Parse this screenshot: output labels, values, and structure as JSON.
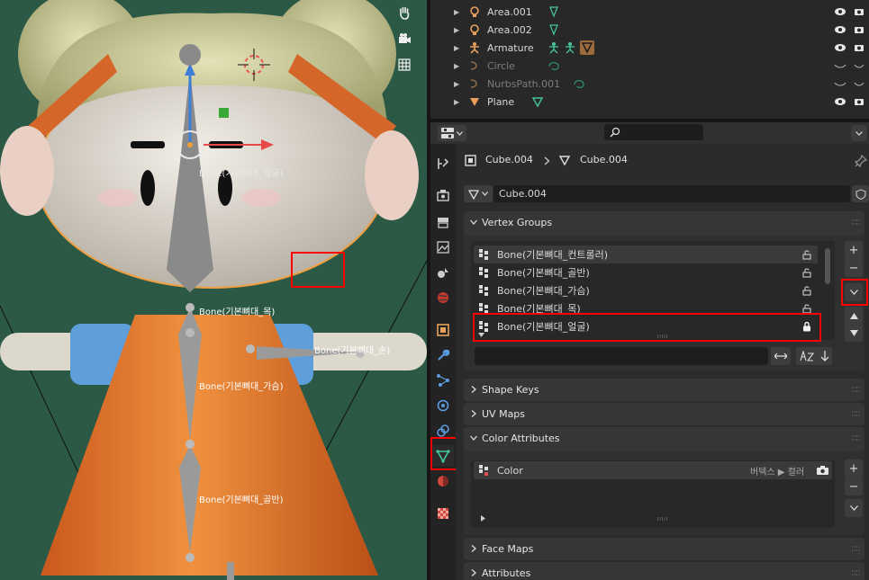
{
  "viewport": {
    "bone_labels": [
      "Bone(기본뼈대_얼굴)",
      "Bone(기본뼈대_목)",
      "Bone(기본뼈대_가슴)",
      "Bone(기본뼈대_골반)",
      "Bone(기본뼈대_손)"
    ]
  },
  "outliner": {
    "rows": [
      {
        "name": "Area.001",
        "icon": "light-icon",
        "dim": false
      },
      {
        "name": "Area.002",
        "icon": "light-icon",
        "dim": false
      },
      {
        "name": "Armature",
        "icon": "armature-icon",
        "dim": false
      },
      {
        "name": "Circle",
        "icon": "curve-icon",
        "dim": true
      },
      {
        "name": "NurbsPath.001",
        "icon": "curve-icon",
        "dim": true
      },
      {
        "name": "Plane",
        "icon": "mesh-icon",
        "dim": false
      }
    ]
  },
  "properties": {
    "breadcrumb_object": "Cube.004",
    "breadcrumb_mesh": "Cube.004",
    "mesh_datablock": "Cube.004",
    "sections": {
      "vertex_groups": "Vertex Groups",
      "shape_keys": "Shape Keys",
      "uv_maps": "UV Maps",
      "color_attributes": "Color Attributes",
      "face_maps": "Face Maps",
      "attributes": "Attributes"
    },
    "vertex_groups": [
      {
        "name": "Bone(기본뼈대_컨트롤러)",
        "locked": false,
        "selected": true
      },
      {
        "name": "Bone(기본뼈대_골반)",
        "locked": false,
        "selected": false
      },
      {
        "name": "Bone(기본뼈대_가슴)",
        "locked": false,
        "selected": false
      },
      {
        "name": "Bone(기본뼈대_목)",
        "locked": false,
        "selected": false
      },
      {
        "name": "Bone(기본뼈대_얼굴)",
        "locked": true,
        "selected": false
      }
    ],
    "color_attribute": {
      "name": "Color",
      "domain": "버텍스 ▶ 컬러"
    }
  }
}
